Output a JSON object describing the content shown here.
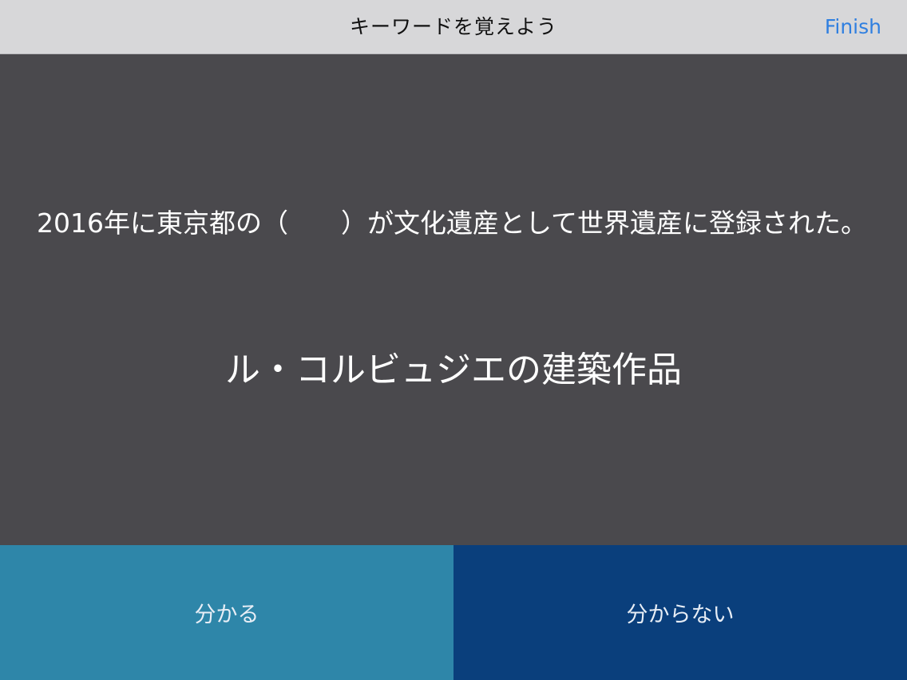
{
  "navbar": {
    "title": "キーワードを覚えよう",
    "finish_label": "Finish"
  },
  "card": {
    "question": "2016年に東京都の（　　）が文化遺産として世界遺産に登録された。",
    "answer": "ル・コルビュジエの建築作品"
  },
  "actions": {
    "know_label": "分かる",
    "dont_know_label": "分からない"
  },
  "colors": {
    "navbar_bg": "#d7d7d9",
    "card_bg": "#4a494d",
    "finish_link": "#2f7fe0",
    "know_button": "#2e86a9",
    "dont_know_button": "#0a3f7c"
  }
}
